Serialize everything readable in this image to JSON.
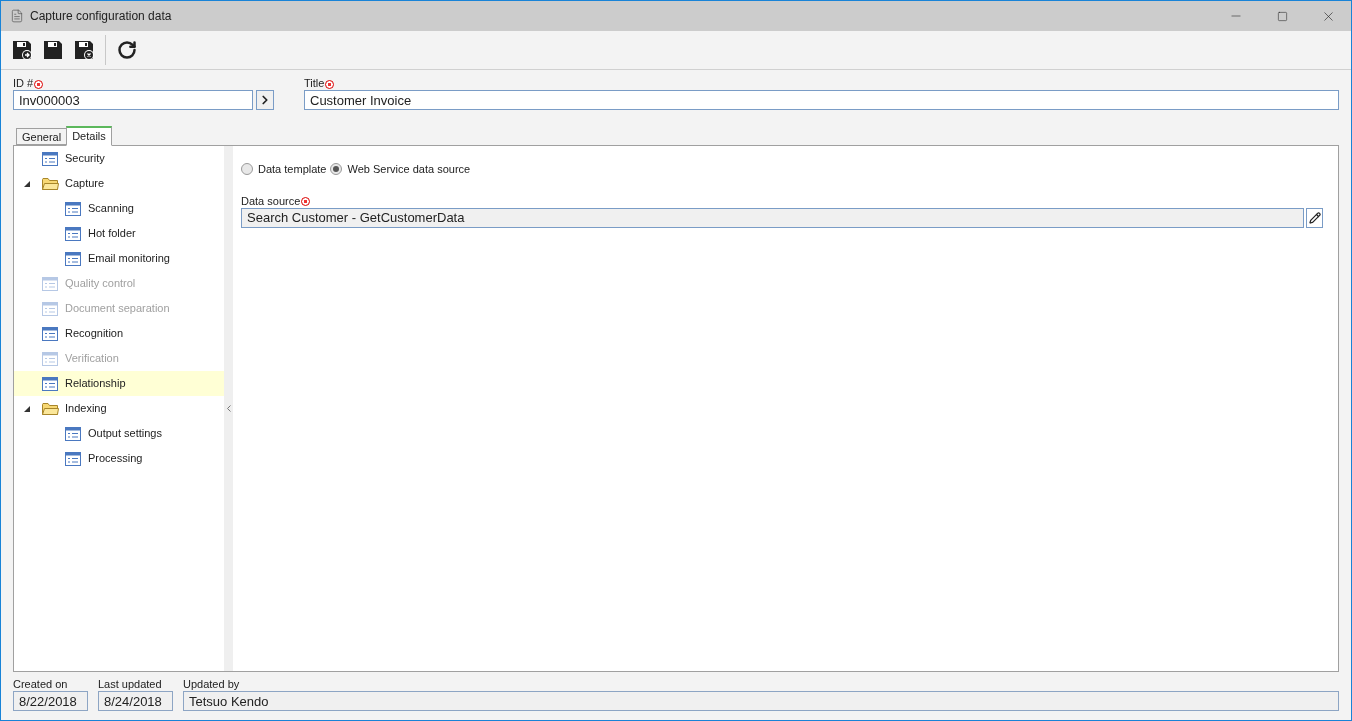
{
  "window": {
    "title": "Capture configuration data"
  },
  "toolbar": {
    "buttons": [
      {
        "kind": "save-add"
      },
      {
        "kind": "save"
      },
      {
        "kind": "save-close"
      },
      {
        "kind": "refresh"
      }
    ]
  },
  "fields": {
    "id": {
      "label": "ID #",
      "required": true,
      "value": "Inv000003"
    },
    "title": {
      "label": "Title",
      "required": true,
      "value": "Customer Invoice"
    }
  },
  "tabs": [
    {
      "label": "General",
      "selected": false
    },
    {
      "label": "Details",
      "selected": true
    }
  ],
  "tree": [
    {
      "label": "Security",
      "kind": "page",
      "disabled": false,
      "selected": false
    },
    {
      "label": "Capture",
      "kind": "folder",
      "expanded": true,
      "disabled": false,
      "selected": false,
      "children": [
        {
          "label": "Scanning",
          "kind": "page",
          "disabled": false,
          "selected": false
        },
        {
          "label": "Hot folder",
          "kind": "page",
          "disabled": false,
          "selected": false
        },
        {
          "label": "Email monitoring",
          "kind": "page",
          "disabled": false,
          "selected": false
        }
      ]
    },
    {
      "label": "Quality control",
      "kind": "page",
      "disabled": true,
      "selected": false
    },
    {
      "label": "Document separation",
      "kind": "page",
      "disabled": true,
      "selected": false
    },
    {
      "label": "Recognition",
      "kind": "page",
      "disabled": false,
      "selected": false
    },
    {
      "label": "Verification",
      "kind": "page",
      "disabled": true,
      "selected": false
    },
    {
      "label": "Relationship",
      "kind": "page",
      "disabled": false,
      "selected": true
    },
    {
      "label": "Indexing",
      "kind": "folder",
      "expanded": true,
      "disabled": false,
      "selected": false,
      "children": [
        {
          "label": "Output settings",
          "kind": "page",
          "disabled": false,
          "selected": false
        },
        {
          "label": "Processing",
          "kind": "page",
          "disabled": false,
          "selected": false
        }
      ]
    }
  ],
  "source_type": [
    {
      "label": "Data template",
      "selected": false
    },
    {
      "label": "Web Service data source",
      "selected": true
    }
  ],
  "data_source": {
    "label": "Data source",
    "required": true,
    "value": "Search Customer - GetCustomerData"
  },
  "footer": [
    {
      "label": "Created on",
      "value": "8/22/2018"
    },
    {
      "label": "Last updated",
      "value": "8/24/2018"
    },
    {
      "label": "Updated by",
      "value": "Tetsuo Kendo"
    }
  ]
}
